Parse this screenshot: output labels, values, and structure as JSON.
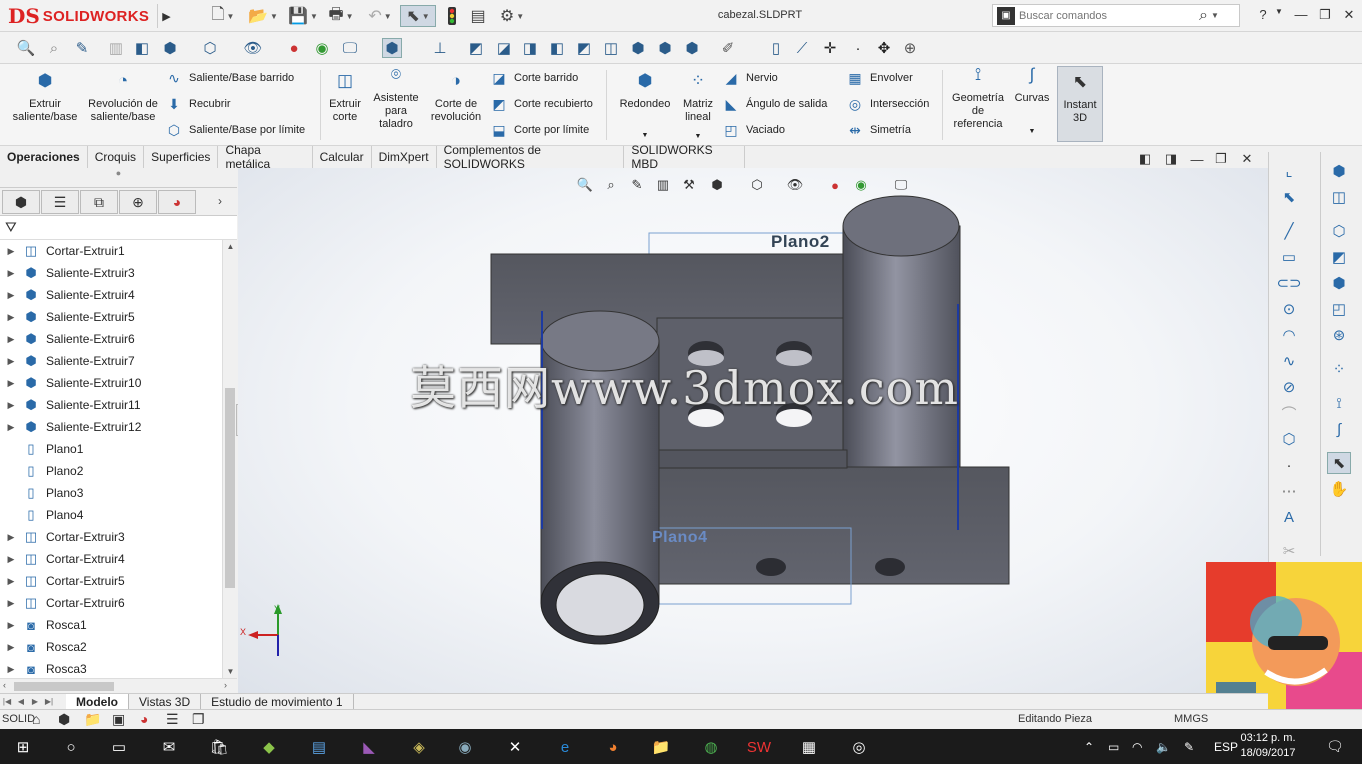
{
  "app": {
    "logo_ds": "DS",
    "logo_text": "SOLIDWORKS",
    "doc_title": "cabezal.SLDPRT"
  },
  "search": {
    "placeholder": "Buscar comandos"
  },
  "cmd": {
    "extruir": "Extruir saliente/base",
    "revolucion": "Revolución de saliente/base",
    "barrido": "Saliente/Base barrido",
    "recubrir": "Recubrir",
    "limite": "Saliente/Base por límite",
    "extruir_corte": "Extruir corte",
    "asistente": "Asistente para taladro",
    "corte_rev": "Corte de revolución",
    "corte_barrido": "Corte barrido",
    "corte_recubierto": "Corte recubierto",
    "corte_limite": "Corte por límite",
    "redondeo": "Redondeo",
    "matriz": "Matriz lineal",
    "nervio": "Nervio",
    "angulo": "Ángulo de salida",
    "vaciado": "Vaciado",
    "envolver": "Envolver",
    "interseccion": "Intersección",
    "simetria": "Simetría",
    "geometria": "Geometría de referencia",
    "curvas": "Curvas",
    "instant3d": "Instant 3D"
  },
  "tabs": [
    "Operaciones",
    "Croquis",
    "Superficies",
    "Chapa metálica",
    "Calcular",
    "DimXpert",
    "Complementos de SOLIDWORKS",
    "SOLIDWORKS MBD"
  ],
  "tree": [
    {
      "label": "Cortar-Extruir1",
      "icon": "cut-extrude-icon",
      "expand": true
    },
    {
      "label": "Saliente-Extruir3",
      "icon": "boss-extrude-icon",
      "expand": true
    },
    {
      "label": "Saliente-Extruir4",
      "icon": "boss-extrude-icon",
      "expand": true
    },
    {
      "label": "Saliente-Extruir5",
      "icon": "boss-extrude-icon",
      "expand": true
    },
    {
      "label": "Saliente-Extruir6",
      "icon": "boss-extrude-icon",
      "expand": true
    },
    {
      "label": "Saliente-Extruir7",
      "icon": "boss-extrude-icon",
      "expand": true
    },
    {
      "label": "Saliente-Extruir10",
      "icon": "boss-extrude-icon",
      "expand": true
    },
    {
      "label": "Saliente-Extruir11",
      "icon": "boss-extrude-icon",
      "expand": true
    },
    {
      "label": "Saliente-Extruir12",
      "icon": "boss-extrude-icon",
      "expand": true
    },
    {
      "label": "Plano1",
      "icon": "plane-icon",
      "expand": false
    },
    {
      "label": "Plano2",
      "icon": "plane-icon",
      "expand": false
    },
    {
      "label": "Plano3",
      "icon": "plane-icon",
      "expand": false
    },
    {
      "label": "Plano4",
      "icon": "plane-icon",
      "expand": false
    },
    {
      "label": "Cortar-Extruir3",
      "icon": "cut-extrude-icon",
      "expand": true
    },
    {
      "label": "Cortar-Extruir4",
      "icon": "cut-extrude-icon",
      "expand": true
    },
    {
      "label": "Cortar-Extruir5",
      "icon": "cut-extrude-icon",
      "expand": true
    },
    {
      "label": "Cortar-Extruir6",
      "icon": "cut-extrude-icon",
      "expand": true
    },
    {
      "label": "Rosca1",
      "icon": "thread-icon",
      "expand": true
    },
    {
      "label": "Rosca2",
      "icon": "thread-icon",
      "expand": true
    },
    {
      "label": "Rosca3",
      "icon": "thread-icon",
      "expand": true
    }
  ],
  "viewport": {
    "plane2": "Plano2",
    "plane4": "Plano4",
    "axis_x": "X",
    "axis_y": "Y",
    "watermark": "莫西网www.3dmox.com"
  },
  "bottom_tabs": [
    "Modelo",
    "Vistas 3D",
    "Estudio de movimiento 1"
  ],
  "status": {
    "left": "SOLID",
    "editing": "Editando Pieza",
    "units": "MMGS"
  },
  "taskbar": {
    "lang": "ESP",
    "time": "03:12 p. m.",
    "date": "18/09/2017"
  },
  "colors": {
    "brand_red": "#d22222",
    "model_gray": "#5d5f6a",
    "accent_blue": "#2a6aa8"
  }
}
